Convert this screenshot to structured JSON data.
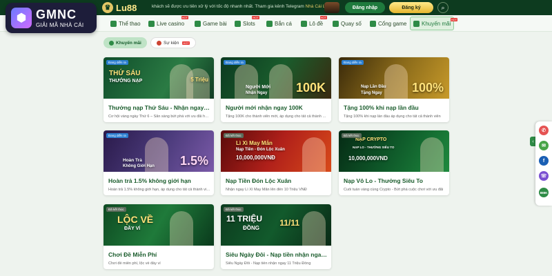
{
  "watermark": {
    "title": "GMNC",
    "subtitle": "GIẢI MÃ NHÀ CÁI"
  },
  "header": {
    "logo": "Lu88",
    "marquee_text": "khách sẽ được ưu tiên xử lý với tốc độ nhanh nhất. Tham gia kênh Telegram",
    "marquee_highlight": "Nhà Cái Lu88 để",
    "login_label": "Đăng nhập",
    "register_label": "Đăng ký"
  },
  "nav": [
    {
      "label": "Thể thao",
      "hot": ""
    },
    {
      "label": "Live casino",
      "hot": "HOT"
    },
    {
      "label": "Game bài",
      "hot": ""
    },
    {
      "label": "Slots",
      "hot": "HOT"
    },
    {
      "label": "Bắn cá",
      "hot": ""
    },
    {
      "label": "Lô đề",
      "hot": "HOT"
    },
    {
      "label": "Quay số",
      "hot": ""
    },
    {
      "label": "Cổng game",
      "hot": ""
    },
    {
      "label": "Khuyến mãi",
      "hot": "HOT"
    }
  ],
  "tabs": {
    "promo": "Khuyến mãi",
    "event": "Sự kiện",
    "event_badge": "HOT"
  },
  "cards": [
    {
      "status": "Đang diễn ra",
      "banner_line1": "THỨ SÁU",
      "banner_line2": "THƯỞNG NẠP",
      "banner_big": "5 Triệu",
      "title": "Thưởng nạp Thứ Sáu - Nhận ngay 5 triệu",
      "desc": "Cơ hội vàng ngày Thứ 6 – Sẵn sàng bứt phá với ưu đãi hấp dẫn"
    },
    {
      "status": "Đang diễn ra",
      "banner_line1": "Người Mới",
      "banner_line2": "Nhận Ngay",
      "banner_big": "100K",
      "title": "Người mới nhận ngay 100K",
      "desc": "Tặng 100K cho thành viên mới, áp dụng cho tất cả thành viên mới"
    },
    {
      "status": "Đang diễn ra",
      "banner_line1": "Nạp Lần Đầu",
      "banner_line2": "Tặng Ngay",
      "banner_big": "100%",
      "title": "Tặng 100% khi nạp lần đầu",
      "desc": "Tặng 100% khi nạp lần đầu áp dụng cho tất cả thành viên"
    },
    {
      "status": "Đang diễn ra",
      "banner_line1": "Hoàn Trả",
      "banner_line2": "Không Giới Hạn",
      "banner_big": "1.5%",
      "title": "Hoàn trả 1.5% không giới hạn",
      "desc": "Hoàn trả 1.5% không giới hạn, áp dụng cho tất cả thành viên"
    },
    {
      "status": "Đã kết thúc",
      "banner_line1": "Lì Xì May Mắn",
      "banner_line2": "Nạp Tiền - Đón Lộc Xuân",
      "banner_big": "10,000,000VNĐ",
      "title": "Nạp Tiền Đón Lộc Xuân",
      "desc": "Nhận ngay Lì Xì May Mắn lên đến 10 Triệu VNĐ"
    },
    {
      "status": "Đã kết thúc",
      "banner_line1": "NẠP CRYPTO",
      "banner_line2": "NẠP LO - THƯỞNG SIÊU TO",
      "banner_big": "10,000,000VND",
      "title": "Nạp Vô Lo - Thưởng Siêu To",
      "desc": "Cuối tuần vàng cùng Crypto - Bứt phá cuộc chơi với ưu đãi"
    },
    {
      "status": "Đã kết thúc",
      "banner_line1": "LỘC VỀ",
      "banner_line2": "ĐẦY VÍ",
      "banner_big": "",
      "title": "Chơi Đề Miễn Phí",
      "desc": "Chơi đề miễn phí, lộc về đầy ví"
    },
    {
      "status": "Đã kết thúc",
      "banner_line1": "11 TRIỆU",
      "banner_line2": "ĐỒNG",
      "banner_big": "11/11",
      "title": "Siêu Ngày Đôi - Nạp tiền nhận ngay 11 Triệu",
      "desc": "Siêu Ngày Đôi - Nạp tiền nhận ngay 11 Triệu Đồng"
    }
  ],
  "rail": [
    "phone-icon",
    "chat-icon",
    "facebook-icon",
    "viber-icon",
    "promo-badge-icon"
  ],
  "rail_badge": "888K"
}
